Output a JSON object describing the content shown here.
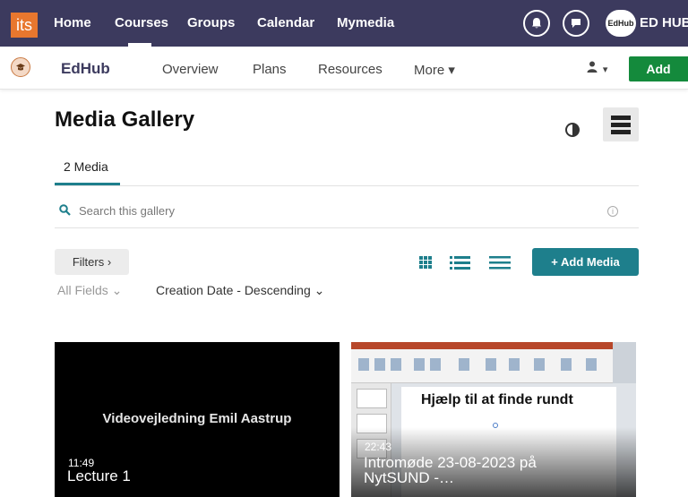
{
  "topbar": {
    "logo": "its",
    "nav": [
      "Home",
      "Courses",
      "Groups",
      "Calendar",
      "Mymedia"
    ],
    "active_nav": "Courses",
    "icons": [
      "bell-icon",
      "chat-icon"
    ],
    "avatar_label": "EdHub",
    "account_name": "ED HUB",
    "background": "#3c3a5e"
  },
  "subnav": {
    "course_name": "EdHub",
    "items": [
      "Overview",
      "Plans",
      "Resources",
      "More ▾"
    ],
    "user_menu": "▾",
    "add_label": "Add",
    "add_color": "#148a3c"
  },
  "gallery": {
    "title": "Media Gallery",
    "tab_label": "2 Media",
    "accent": "#1e7f8c",
    "search": {
      "placeholder": "Search this gallery",
      "info": "i"
    },
    "filters_label": "Filters ›",
    "view_modes": [
      "grid-view-icon",
      "detailed-list-icon",
      "compact-list-icon"
    ],
    "add_media_label": "+ Add Media",
    "field_filter": "All Fields ⌄",
    "sort": "Creation Date - Descending ⌄"
  },
  "media": [
    {
      "banner": "Videovejledning Emil Aastrup",
      "duration": "11:49",
      "title": "Lecture 1"
    },
    {
      "slide_heading": "Hjælp til at finde rundt",
      "duration": "22:43",
      "title": "Intromøde 23-08-2023 på\nNytSUND -…"
    }
  ]
}
